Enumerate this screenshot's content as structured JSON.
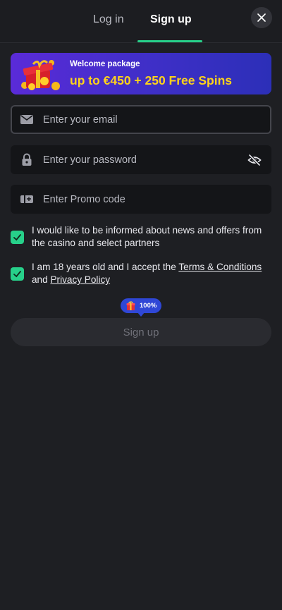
{
  "tabs": {
    "login": "Log in",
    "signup": "Sign up"
  },
  "banner": {
    "subtitle": "Welcome package",
    "headline": "up to €450 + 250 Free Spins"
  },
  "fields": {
    "email_placeholder": "Enter your email",
    "password_placeholder": "Enter your password",
    "promo_placeholder": "Enter Promo code"
  },
  "consents": {
    "news_text": "I would like to be informed about news and offers from the casino and select partners",
    "age_prefix": "I am 18 years old and I accept the ",
    "terms_link": "Terms & Conditions",
    "and_word": " and ",
    "privacy_link": "Privacy Policy"
  },
  "bonus_badge": {
    "percent": "100%"
  },
  "submit": {
    "label": "Sign up"
  },
  "colors": {
    "accent": "#27d08a",
    "banner_text": "#ffd31a",
    "background": "#1e1f23",
    "badge": "#2f47d6"
  },
  "icons": [
    "close-icon",
    "gift-icon",
    "email-icon",
    "lock-icon",
    "eye-off-icon",
    "promo-ticket-icon",
    "check-icon"
  ]
}
